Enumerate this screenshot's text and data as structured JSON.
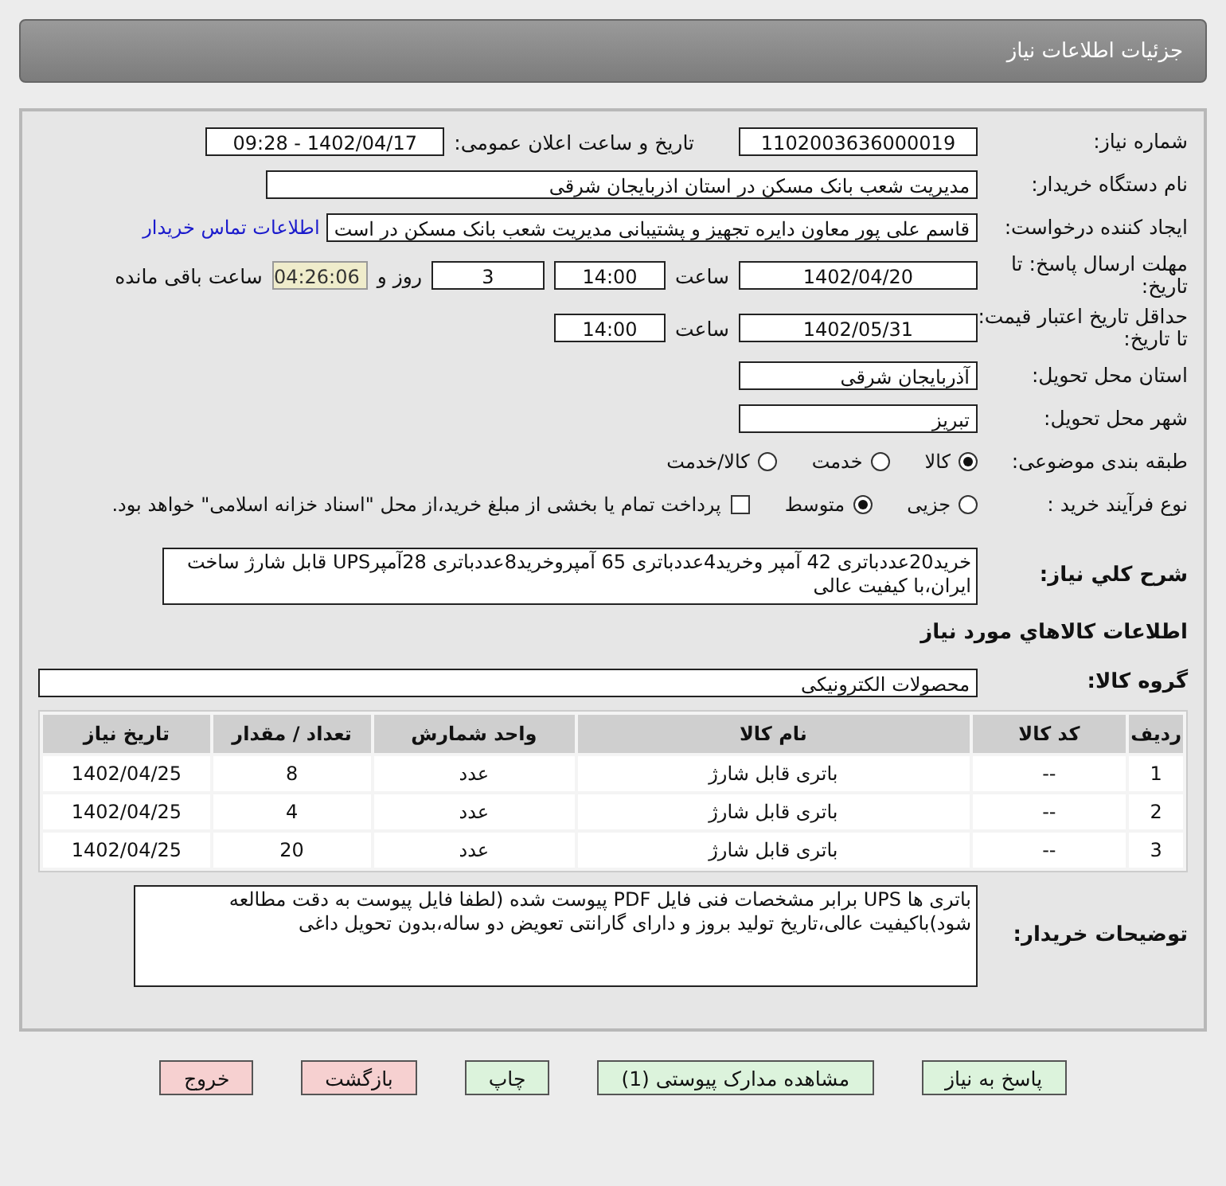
{
  "header": {
    "title": "جزئیات اطلاعات نیاز"
  },
  "need_number": {
    "label": "شماره نیاز:",
    "value": "1102003636000019"
  },
  "announce": {
    "label": "تاریخ و ساعت اعلان عمومی:",
    "value": "1402/04/17 - 09:28"
  },
  "buyer_org": {
    "label": "نام دستگاه خریدار:",
    "value": "مدیریت شعب بانک مسکن در استان اذربایجان شرقی"
  },
  "creator": {
    "label": "ایجاد کننده درخواست:",
    "value": "قاسم علی پور معاون دایره تجهیز و پشتیبانی مدیریت شعب بانک مسکن در است",
    "link": "اطلاعات تماس خریدار"
  },
  "deadline": {
    "label": "مهلت ارسال پاسخ: تا تاریخ:",
    "date": "1402/04/20",
    "time_label": "ساعت",
    "time": "14:00",
    "days": "3",
    "days_label": "روز و",
    "remaining": "04:26:06",
    "remaining_label": "ساعت باقی مانده"
  },
  "validity": {
    "label": "حداقل تاریخ اعتبار قیمت: تا تاریخ:",
    "date": "1402/05/31",
    "time_label": "ساعت",
    "time": "14:00"
  },
  "province": {
    "label": "استان محل تحویل:",
    "value": "آذربایجان شرقی"
  },
  "city": {
    "label": "شهر محل تحویل:",
    "value": "تبریز"
  },
  "category": {
    "label": "طبقه بندی موضوعی:",
    "options": [
      {
        "label": "کالا",
        "selected": true
      },
      {
        "label": "خدمت",
        "selected": false
      },
      {
        "label": "کالا/خدمت",
        "selected": false
      }
    ]
  },
  "process": {
    "label": "نوع فرآیند خرید :",
    "options": [
      {
        "label": "جزیی",
        "selected": false
      },
      {
        "label": "متوسط",
        "selected": true
      }
    ],
    "treasury": {
      "label": "پرداخت تمام یا بخشی از مبلغ خرید،از محل \"اسناد خزانه اسلامی\" خواهد بود.",
      "checked": false
    }
  },
  "summary": {
    "label": "شرح کلي نياز:",
    "value": "خرید20عددباتری 42 آمپر وخرید4عددباتری 65 آمپروخرید8عددباتری 28آمپرUPS قابل شارژ ساخت ایران،با کیفیت عالی"
  },
  "goods_heading": "اطلاعات کالاهاي مورد نياز",
  "goods_group": {
    "label": "گروه کالا:",
    "value": "محصولات الکترونیکی"
  },
  "table": {
    "columns": [
      "ردیف",
      "کد کالا",
      "نام کالا",
      "واحد شمارش",
      "تعداد / مقدار",
      "تاریخ نیاز"
    ],
    "rows": [
      [
        "1",
        "--",
        "باتری قابل شارژ",
        "عدد",
        "8",
        "1402/04/25"
      ],
      [
        "2",
        "--",
        "باتری قابل شارژ",
        "عدد",
        "4",
        "1402/04/25"
      ],
      [
        "3",
        "--",
        "باتری قابل شارژ",
        "عدد",
        "20",
        "1402/04/25"
      ]
    ]
  },
  "buyer_notes": {
    "label": "توضیحات خریدار:",
    "value": "باتری ها UPS برابر مشخصات فنی فایل PDF پیوست شده (لطفا فایل پیوست به دقت مطالعه شود)باکیفیت عالی،تاریخ تولید بروز و دارای گارانتی تعویض دو ساله،بدون تحویل داغی"
  },
  "buttons": [
    {
      "label": "پاسخ به نیاز",
      "kind": "primary"
    },
    {
      "label": "مشاهده مدارک پیوستی (1)",
      "kind": "primary"
    },
    {
      "label": "چاپ",
      "kind": "primary"
    },
    {
      "label": "بازگشت",
      "kind": "danger"
    },
    {
      "label": "خروج",
      "kind": "danger"
    }
  ]
}
